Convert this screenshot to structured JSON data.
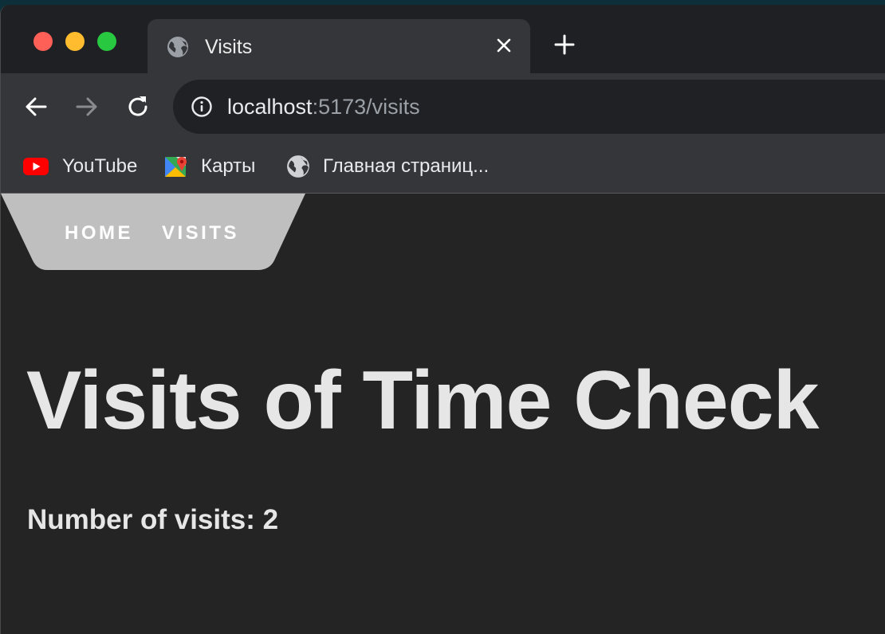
{
  "browser": {
    "tab": {
      "title": "Visits"
    },
    "address_bar": {
      "host": "localhost",
      "path": ":5173/visits"
    },
    "bookmarks": [
      {
        "label": "YouTube",
        "icon": "youtube-icon"
      },
      {
        "label": "Карты",
        "icon": "google-maps-icon"
      },
      {
        "label": "Главная страниц...",
        "icon": "globe-icon"
      }
    ]
  },
  "page": {
    "nav": [
      {
        "label": "HOME"
      },
      {
        "label": "VISITS"
      }
    ],
    "title": "Visits of Time Check",
    "visits_text": "Number of visits: 2"
  },
  "colors": {
    "page_background": "#242424",
    "navbar_background": "#bfbfbf",
    "title_text": "#e6e6e6"
  }
}
